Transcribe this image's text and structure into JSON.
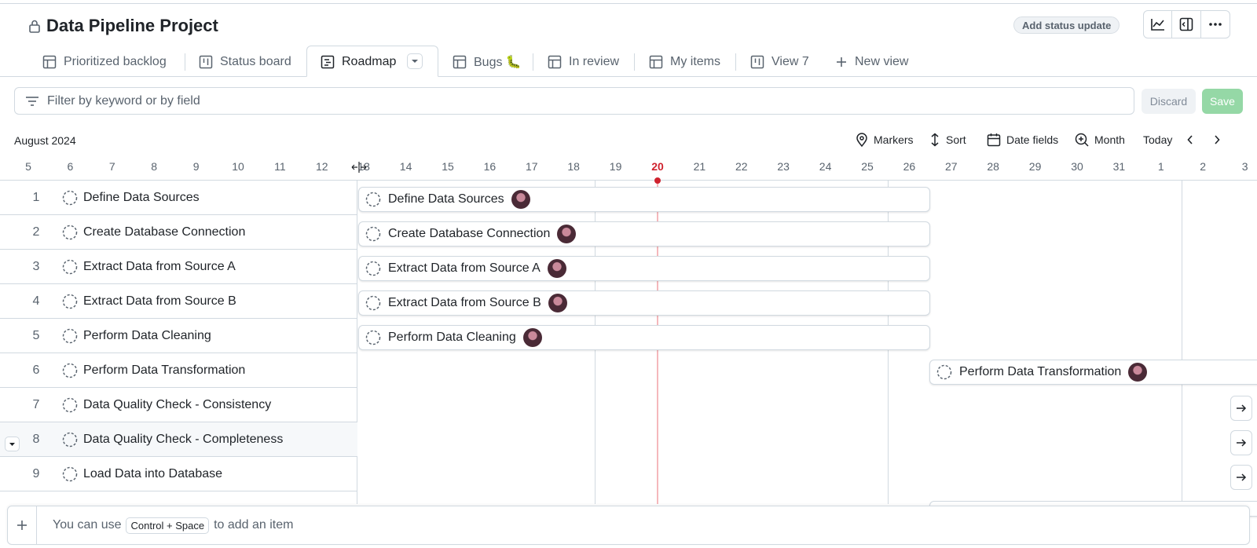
{
  "header": {
    "title": "Data Pipeline Project",
    "status_button": "Add status update",
    "icons": [
      "insights-icon",
      "side-panel-icon",
      "kebab-icon"
    ]
  },
  "tabs": [
    {
      "label": "Prioritized backlog",
      "icon": "table-icon"
    },
    {
      "label": "Status board",
      "icon": "board-icon"
    },
    {
      "label": "Roadmap",
      "icon": "roadmap-icon",
      "active": true
    },
    {
      "label": "Bugs 🐛",
      "icon": "table-icon"
    },
    {
      "label": "In review",
      "icon": "table-icon"
    },
    {
      "label": "My items",
      "icon": "table-icon"
    },
    {
      "label": "View 7",
      "icon": "board-icon"
    },
    {
      "label": "New view",
      "icon": "plus-icon"
    }
  ],
  "filter": {
    "placeholder": "Filter by keyword or by field",
    "value": "",
    "discard_label": "Discard",
    "save_label": "Save"
  },
  "timeline": {
    "month_label": "August 2024",
    "controls": {
      "markers": "Markers",
      "sort": "Sort",
      "date_fields": "Date fields",
      "zoom": "Month",
      "today": "Today"
    },
    "days": [
      "5",
      "6",
      "7",
      "8",
      "9",
      "10",
      "11",
      "12",
      "13",
      "14",
      "15",
      "16",
      "17",
      "18",
      "19",
      "20",
      "21",
      "22",
      "23",
      "24",
      "25",
      "26",
      "27",
      "28",
      "29",
      "30",
      "31",
      "1",
      "2",
      "3"
    ],
    "today": "20"
  },
  "items": [
    {
      "num": "1",
      "title": "Define Data Sources"
    },
    {
      "num": "2",
      "title": "Create Database Connection"
    },
    {
      "num": "3",
      "title": "Extract Data from Source A"
    },
    {
      "num": "4",
      "title": "Extract Data from Source B"
    },
    {
      "num": "5",
      "title": "Perform Data Cleaning"
    },
    {
      "num": "6",
      "title": "Perform Data Transformation"
    },
    {
      "num": "7",
      "title": "Data Quality Check - Consistency"
    },
    {
      "num": "8",
      "title": "Data Quality Check - Completeness"
    },
    {
      "num": "9",
      "title": "Load Data into Database"
    }
  ],
  "add_item": {
    "prefix": "You can use",
    "shortcut": "Control + Space",
    "suffix": "to add an item"
  },
  "colors": {
    "today": "#cf222e",
    "save": "#95d8a6",
    "border": "#d1d9e0"
  }
}
